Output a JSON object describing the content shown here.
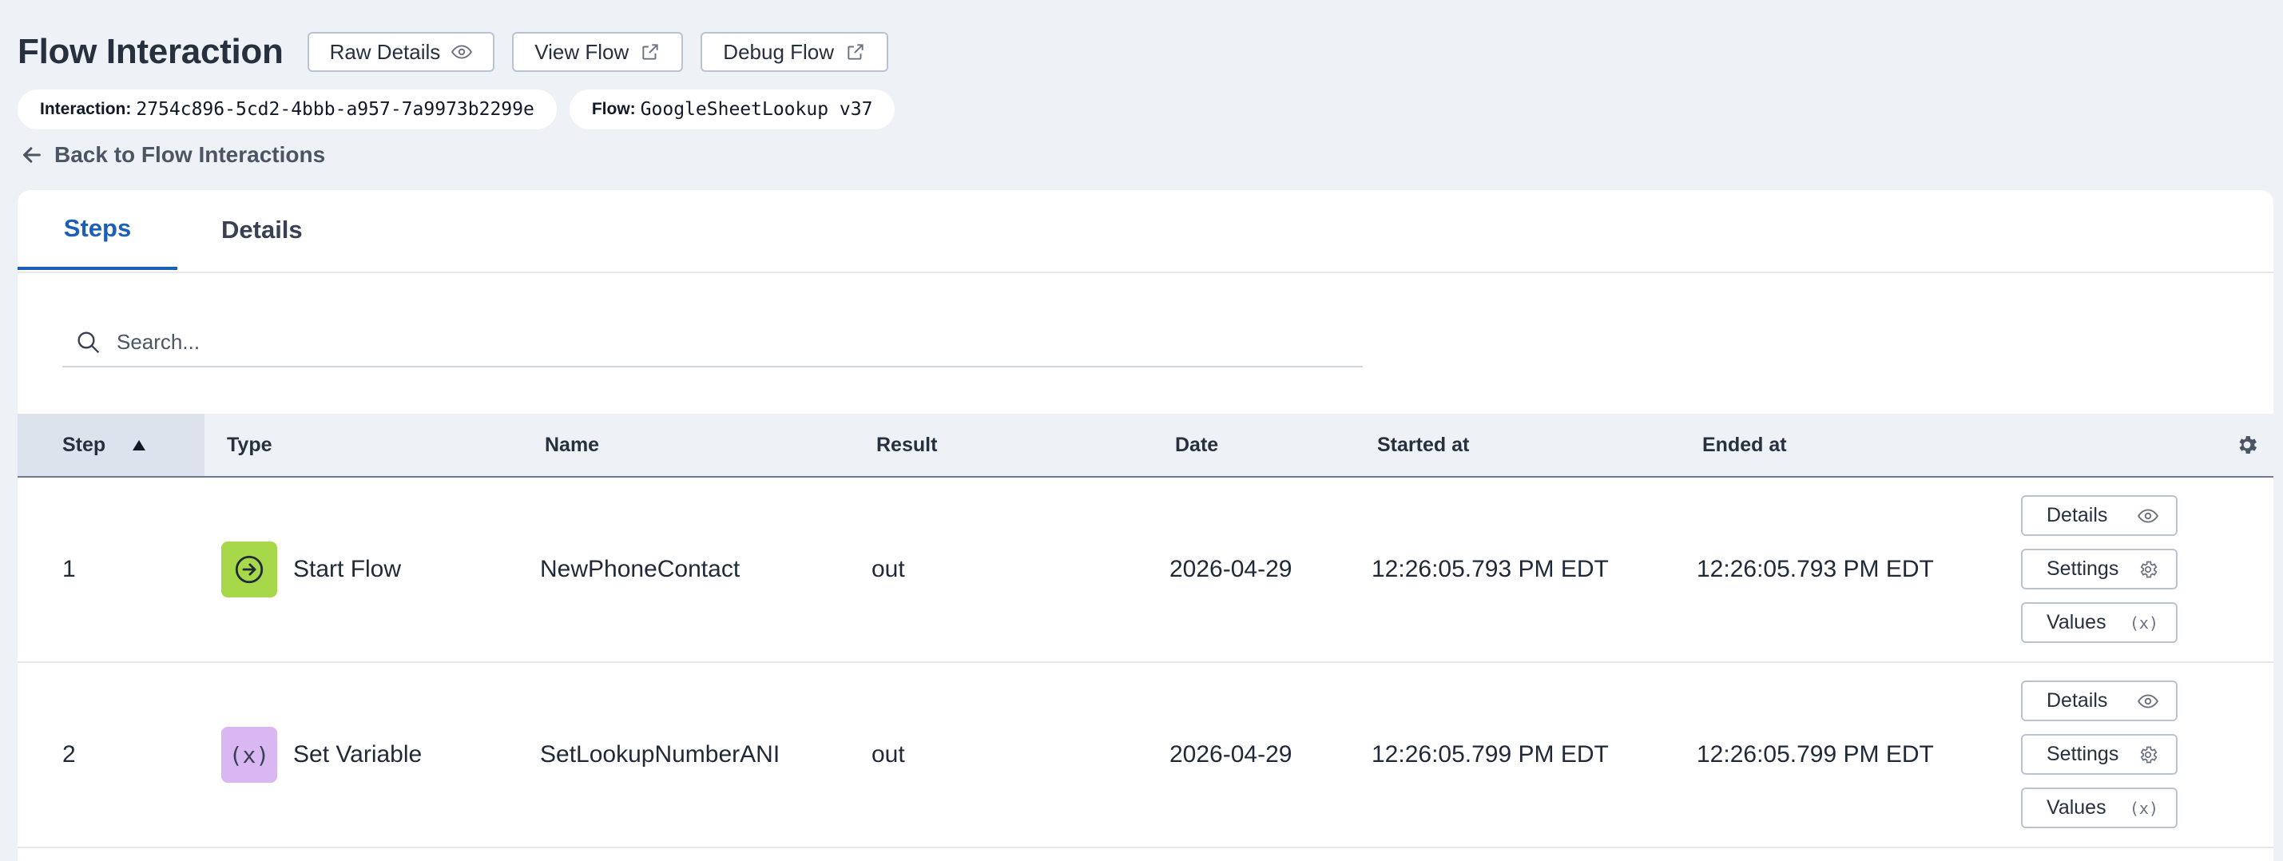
{
  "header": {
    "title": "Flow Interaction",
    "buttons": {
      "raw_details": "Raw Details",
      "view_flow": "View Flow",
      "debug_flow": "Debug Flow"
    }
  },
  "chips": {
    "interaction_label": "Interaction:",
    "interaction_value": "2754c896-5cd2-4bbb-a957-7a9973b2299e",
    "flow_label": "Flow:",
    "flow_value": "GoogleSheetLookup v37"
  },
  "back_link": "Back to Flow Interactions",
  "tabs": [
    {
      "label": "Steps",
      "active": true
    },
    {
      "label": "Details",
      "active": false
    }
  ],
  "search": {
    "placeholder": "Search...",
    "value": ""
  },
  "table": {
    "columns": {
      "step": "Step",
      "type": "Type",
      "name": "Name",
      "result": "Result",
      "date": "Date",
      "started": "Started at",
      "ended": "Ended at"
    },
    "sort": {
      "column": "step",
      "direction": "ascending"
    },
    "rows": [
      {
        "step": "1",
        "type": "Start Flow",
        "type_icon": "arrow-circle-right-icon",
        "type_color": "#a6d84a",
        "name": "NewPhoneContact",
        "result": "out",
        "date": "2026-04-29",
        "started": "12:26:05.793 PM EDT",
        "ended": "12:26:05.793 PM EDT"
      },
      {
        "step": "2",
        "type": "Set Variable",
        "type_icon": "variable-icon",
        "type_color": "#d9b7f2",
        "name": "SetLookupNumberANI",
        "result": "out",
        "date": "2026-04-29",
        "started": "12:26:05.799 PM EDT",
        "ended": "12:26:05.799 PM EDT"
      }
    ],
    "row_actions": {
      "details": "Details",
      "settings": "Settings",
      "values": "Values"
    }
  },
  "colors": {
    "accent": "#1d5fb8",
    "page_bg": "#eef1f6",
    "start_flow": "#a6d84a",
    "set_variable": "#d9b7f2"
  }
}
